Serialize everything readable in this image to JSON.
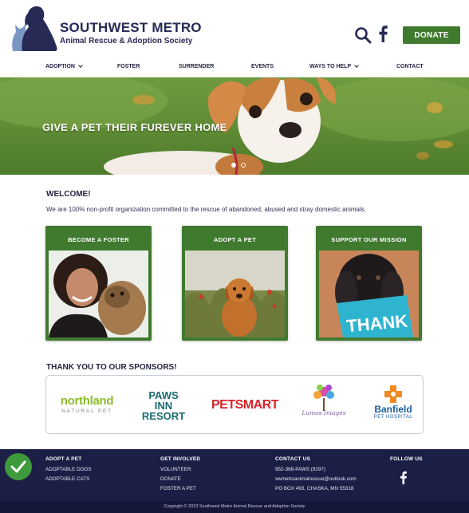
{
  "header": {
    "org_name": "SOUTHWEST METRO",
    "org_subtitle": "Animal Rescue & Adoption Society",
    "donate_label": "DONATE",
    "icons": [
      "search-icon",
      "facebook-icon"
    ],
    "accent_color": "#3f7a2f",
    "navy_color": "#1c1f45"
  },
  "nav": {
    "items": [
      {
        "label": "ADOPTION",
        "has_dropdown": true
      },
      {
        "label": "FOSTER",
        "has_dropdown": false
      },
      {
        "label": "SURRENDER",
        "has_dropdown": false
      },
      {
        "label": "EVENTS",
        "has_dropdown": false
      },
      {
        "label": "WAYS TO HELP",
        "has_dropdown": true
      },
      {
        "label": "CONTACT",
        "has_dropdown": false
      }
    ]
  },
  "hero": {
    "headline": "GIVE A PET THEIR FUREVER HOME",
    "slide_count": 2,
    "active_slide": 1
  },
  "welcome": {
    "title": "WELCOME!",
    "text": "We are 100% non-profit organization committed to the rescue of abandoned, abused and stray domestic animals."
  },
  "cards": [
    {
      "label": "BECOME A FOSTER"
    },
    {
      "label": "ADOPT A PET"
    },
    {
      "label": "SUPPORT OUR MISSION",
      "sign_text": "THANK"
    }
  ],
  "sponsors": {
    "title": "THANK YOU TO OUR SPONSORS!",
    "logos": [
      {
        "line1": "northland",
        "line2": "NATURAL PET"
      },
      {
        "line1": "PAWS",
        "line2": "INN",
        "line3": "RESORT"
      },
      {
        "line1": "PETSMART"
      },
      {
        "line1": "Lumos",
        "line2": "Images"
      },
      {
        "line1": "Banfield",
        "line2": "PET HOSPITAL"
      }
    ]
  },
  "footer": {
    "adopt": {
      "heading": "ADOPT A PET",
      "links": [
        "ADOPTABLE DOGS",
        "ADOPTABLE CATS"
      ]
    },
    "involved": {
      "heading": "GET INVOLVED",
      "links": [
        "VOLUNTEER",
        "DONATE",
        "FOSTER A PET"
      ]
    },
    "contact": {
      "heading": "CONTACT US",
      "lines": [
        "952-368-PAWS (9297)",
        "swmetroanimalrescue@outlook.com",
        "PO BOX 493, CHASKA, MN 55318"
      ]
    },
    "follow": {
      "heading": "FOLLOW US"
    },
    "copyright": "Copyright © 2023 Southwest Metro Animal Rescue and Adoption Society"
  }
}
